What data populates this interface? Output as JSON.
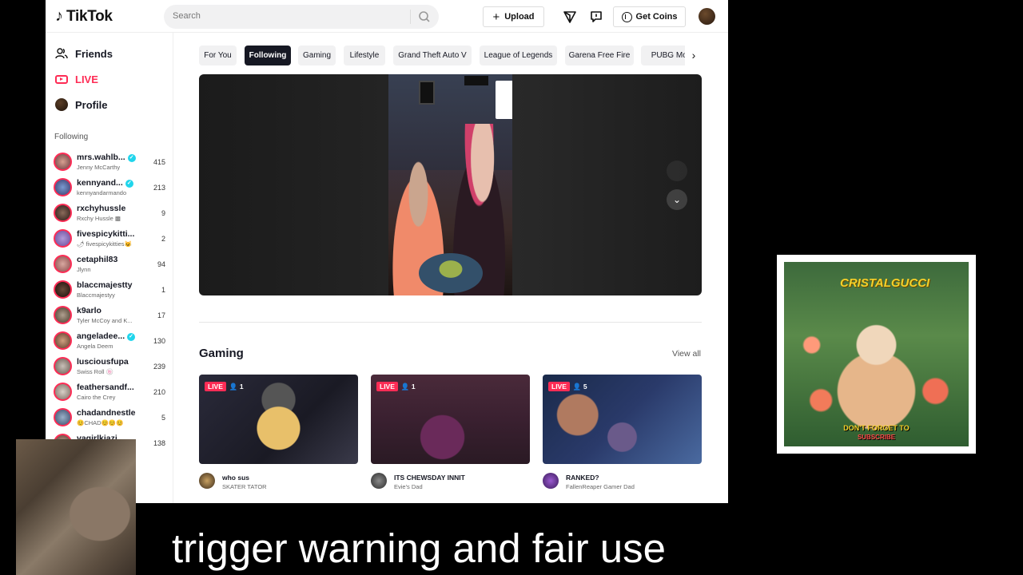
{
  "header": {
    "logo": "TikTok",
    "search_placeholder": "Search",
    "upload_label": "Upload",
    "coins_label": "Get Coins"
  },
  "sidebar": {
    "nav": [
      {
        "label": "Friends",
        "icon": "friends-icon"
      },
      {
        "label": "LIVE",
        "icon": "live-icon"
      },
      {
        "label": "Profile",
        "icon": "profile-avatar"
      }
    ],
    "following_title": "Following",
    "following": [
      {
        "name": "mrs.wahlb...",
        "sub": "Jenny McCarthy",
        "count": "415",
        "verified": true
      },
      {
        "name": "kennyand...",
        "sub": "kennyandarmando",
        "count": "213",
        "verified": true
      },
      {
        "name": "rxchyhussle",
        "sub": "Rxchy Hussle ▩",
        "count": "9",
        "verified": false
      },
      {
        "name": "fivespicykitti...",
        "sub": "🌶 fivespicykitties😺",
        "count": "2",
        "verified": false
      },
      {
        "name": "cetaphil83",
        "sub": "Jlynn",
        "count": "94",
        "verified": false
      },
      {
        "name": "blaccmajestty",
        "sub": "Blaccmajestyy",
        "count": "1",
        "verified": false
      },
      {
        "name": "k9arlo",
        "sub": "Tyler McCoy and K...",
        "count": "17",
        "verified": false
      },
      {
        "name": "angeladee...",
        "sub": "Angela Deem",
        "count": "130",
        "verified": true
      },
      {
        "name": "lusciousfupa",
        "sub": "Swiss Roll 🍥",
        "count": "239",
        "verified": false
      },
      {
        "name": "feathersandf...",
        "sub": "Cairo the Crey",
        "count": "210",
        "verified": false
      },
      {
        "name": "chadandnestle",
        "sub": "😊CHAD😊😊😊",
        "count": "5",
        "verified": false
      },
      {
        "name": "vagirlkiazi",
        "sub": "",
        "count": "138",
        "verified": false
      }
    ]
  },
  "tabs": [
    "For You",
    "Following",
    "Gaming",
    "Lifestyle",
    "Grand Theft Auto V",
    "League of Legends",
    "Garena Free Fire",
    "PUBG Mob"
  ],
  "active_tab": "Following",
  "section": {
    "title": "Gaming",
    "view_all": "View all",
    "cards": [
      {
        "live": "LIVE",
        "viewers": "1",
        "title": "who sus",
        "user": "SKATER TATOR"
      },
      {
        "live": "LIVE",
        "viewers": "1",
        "title": "ITS CHEWSDAY INNIT",
        "user": "Evie's Dad"
      },
      {
        "live": "LIVE",
        "viewers": "5",
        "title": "RANKED?",
        "user": "FallenReaper Gamer Dad"
      }
    ]
  },
  "overlay": {
    "brand": "CRISTALGUCCI",
    "dont_forget": "DON'T FORGET TO",
    "subscribe": "SUBSCRIBE",
    "caption": "trigger warning and fair use"
  },
  "colors": {
    "accent": "#fe2c55",
    "verified": "#20d5ec"
  }
}
